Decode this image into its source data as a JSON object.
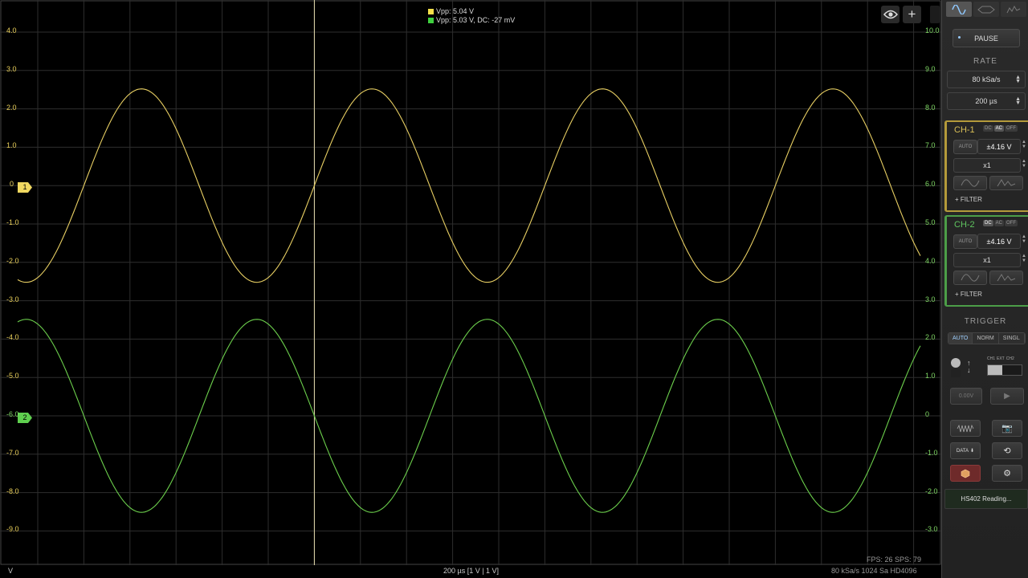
{
  "chart_data": {
    "type": "line",
    "title": "",
    "xlabel": "",
    "ylabel": "V",
    "ylim_ch1": [
      -9.0,
      4.0
    ],
    "y_ticks_left": [
      "4.0",
      "3.0",
      "2.0",
      "1.0",
      "0",
      "-1.0",
      "-2.0",
      "-3.0",
      "-4.0",
      "-5.0",
      "-6.0",
      "-7.0",
      "-8.0",
      "-9.0"
    ],
    "y_ticks_right": [
      "10.0",
      "9.0",
      "8.0",
      "7.0",
      "6.0",
      "5.0",
      "4.0",
      "3.0",
      "2.0",
      "1.0",
      "0",
      "-1.0",
      "-2.0",
      "-3.0"
    ],
    "grid": true,
    "series": [
      {
        "name": "CH-1",
        "color": "#e8cf63",
        "amplitude_v": 2.52,
        "offset_v": 0,
        "period_divisions": 5.0,
        "phase_divisions": 6.0,
        "min_v": -2.52,
        "max_v": 2.52
      },
      {
        "name": "CH-2",
        "color": "#6ccf4c",
        "amplitude_v": 2.515,
        "offset_v": -6.0,
        "period_divisions": 5.0,
        "phase_divisions": 3.5,
        "min_v": -8.5,
        "max_v": -3.5
      }
    ]
  },
  "legend": {
    "ch1": {
      "text": "Vpp: 5.04 V",
      "color": "#f5e04a"
    },
    "ch2": {
      "text": "Vpp: 5.03 V, DC: -27 mV",
      "color": "#3fd03f"
    }
  },
  "markers": {
    "ch1": "1",
    "ch2": "2",
    "ch1_zero": "0",
    "ch2_zero": "-6.0"
  },
  "overlay": {
    "eye_icon": "eye-icon",
    "add_icon": "plus-icon"
  },
  "bottom": {
    "unit": "V",
    "timebase": "200 µs  [1 V | 1 V]",
    "stats": "FPS: 26  SPS: 79",
    "acq": "80 kSa/s   1024 Sa   HD4096"
  },
  "panel": {
    "pause": "PAUSE",
    "rate_title": "RATE",
    "rate_value": "80 kSa/s",
    "timebase_value": "200 µs",
    "ch1": {
      "title": "CH-1",
      "color": "#e0c35a",
      "coupling": [
        "DC",
        "AC",
        "OFF"
      ],
      "auto": "AUTO",
      "range": "±4.16 V",
      "probe": "x1",
      "filter": "+ FILTER"
    },
    "ch2": {
      "title": "CH-2",
      "color": "#5fc45f",
      "coupling": [
        "DC",
        "AC",
        "OFF"
      ],
      "auto": "AUTO",
      "range": "±4.16 V",
      "probe": "x1",
      "filter": "+ FILTER"
    },
    "trigger_title": "TRIGGER",
    "trigger_modes": [
      "AUTO",
      "NORM",
      "SINGL"
    ],
    "trigger_src": [
      "CH1",
      "EXT",
      "CH2"
    ],
    "trigger_level": "0.00V",
    "data_label": "DATA",
    "status": "HS402 Reading..."
  },
  "colors": {
    "ch1": "#e8cf63",
    "ch2": "#6ccf4c",
    "grid": "#2e2e2e",
    "cursor": "#e8e0b0"
  }
}
